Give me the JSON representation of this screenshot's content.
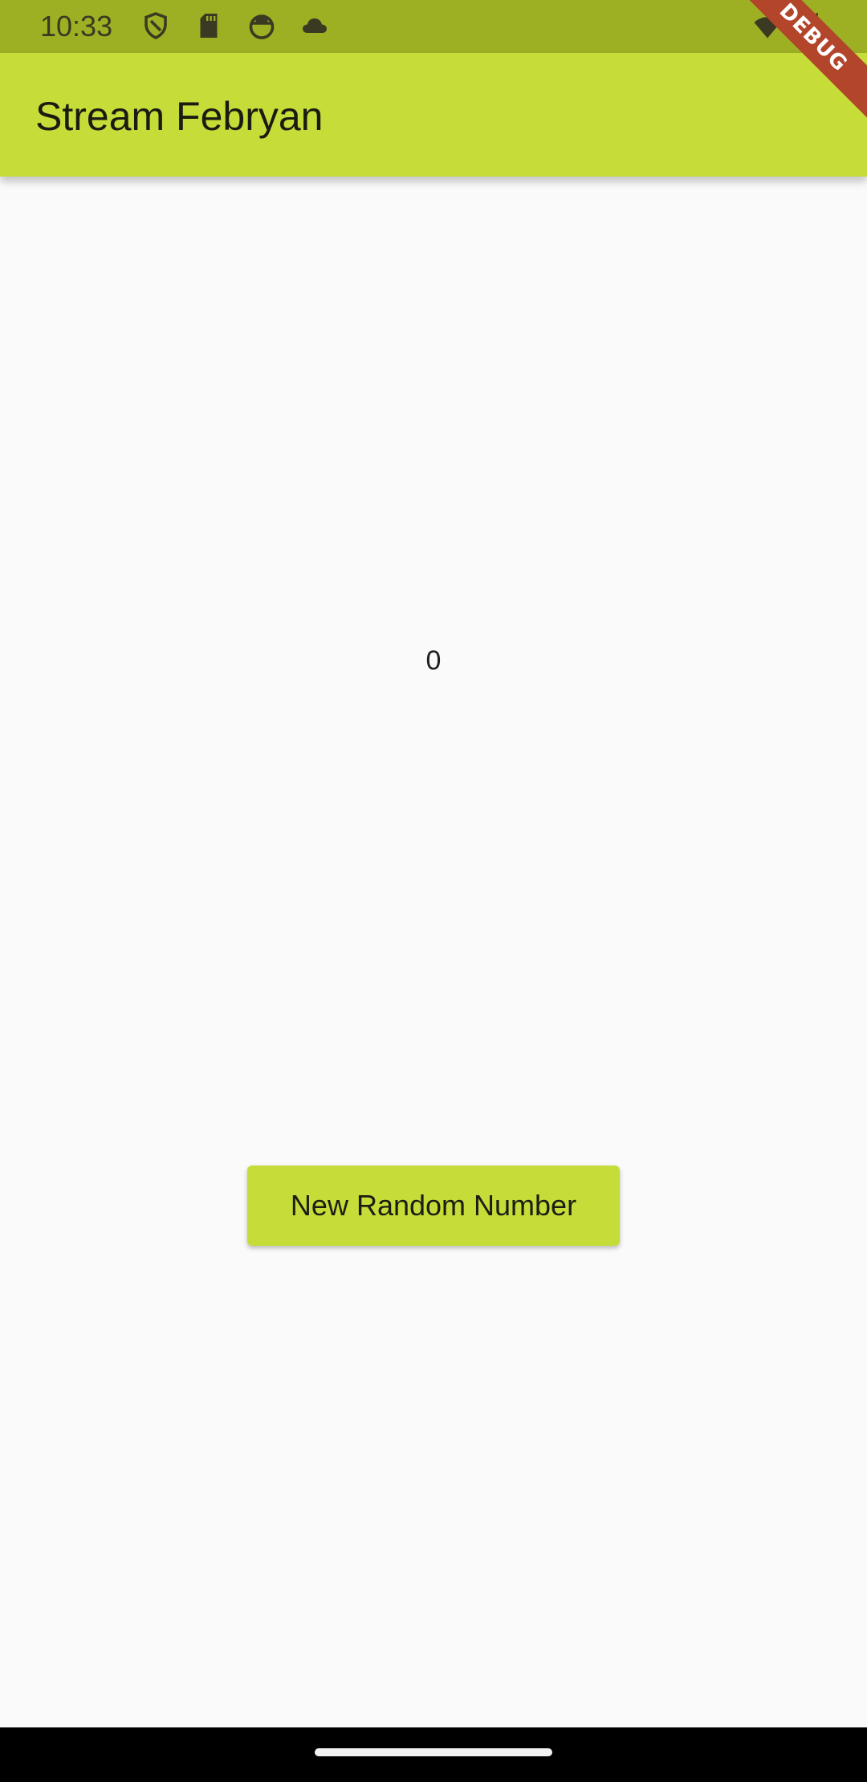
{
  "status_bar": {
    "time": "10:33",
    "left_icons": [
      "vpn-shield-icon",
      "sd-card-icon",
      "app-notification-icon",
      "cloud-icon"
    ],
    "right_icons": [
      "wifi-icon",
      "signal-icon"
    ]
  },
  "debug_banner": {
    "label": "DEBUG"
  },
  "app_bar": {
    "title": "Stream Febryan"
  },
  "main": {
    "number": "0",
    "button_label": "New Random Number"
  },
  "colors": {
    "primary": "#c6dc38",
    "status_bar": "#9db024",
    "background": "#fafafa",
    "debug_banner": "#b2452a"
  }
}
